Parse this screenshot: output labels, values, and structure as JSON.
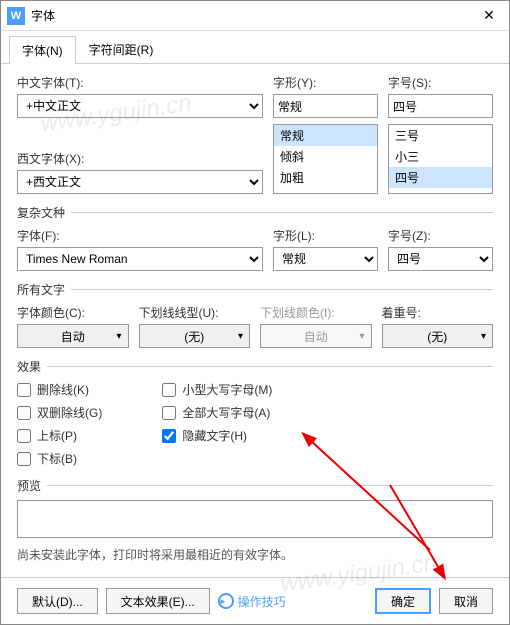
{
  "window": {
    "title": "字体"
  },
  "tabs": {
    "font": "字体(N)",
    "spacing": "字符间距(R)"
  },
  "labels": {
    "cjkFont": "中文字体(T):",
    "style": "字形(Y):",
    "size": "字号(S):",
    "westFont": "西文字体(X):",
    "complex": "复杂文种",
    "cFont": "字体(F):",
    "cStyle": "字形(L):",
    "cSize": "字号(Z):",
    "allText": "所有文字",
    "fontColor": "字体颜色(C):",
    "ulStyle": "下划线线型(U):",
    "ulColor": "下划线颜色(I):",
    "emphasis": "着重号:",
    "effects": "效果",
    "preview": "预览"
  },
  "values": {
    "cjkFont": "+中文正文",
    "westFont": "+西文正文",
    "styleInput": "常规",
    "sizeInput": "四号",
    "cFont": "Times New Roman",
    "cStyle": "常规",
    "cSize": "四号",
    "fontColor": "自动",
    "ulStyle": "(无)",
    "ulColor": "自动",
    "emphasis": "(无)"
  },
  "styleList": [
    "常规",
    "倾斜",
    "加粗"
  ],
  "sizeList": [
    "三号",
    "小三",
    "四号"
  ],
  "checks": {
    "strike": "删除线(K)",
    "dstrike": "双删除线(G)",
    "sup": "上标(P)",
    "sub": "下标(B)",
    "smallcaps": "小型大写字母(M)",
    "allcaps": "全部大写字母(A)",
    "hidden": "隐藏文字(H)"
  },
  "note": "尚未安装此字体，打印时将采用最相近的有效字体。",
  "buttons": {
    "default": "默认(D)...",
    "textfx": "文本效果(E)...",
    "tips": "操作技巧",
    "ok": "确定",
    "cancel": "取消"
  }
}
